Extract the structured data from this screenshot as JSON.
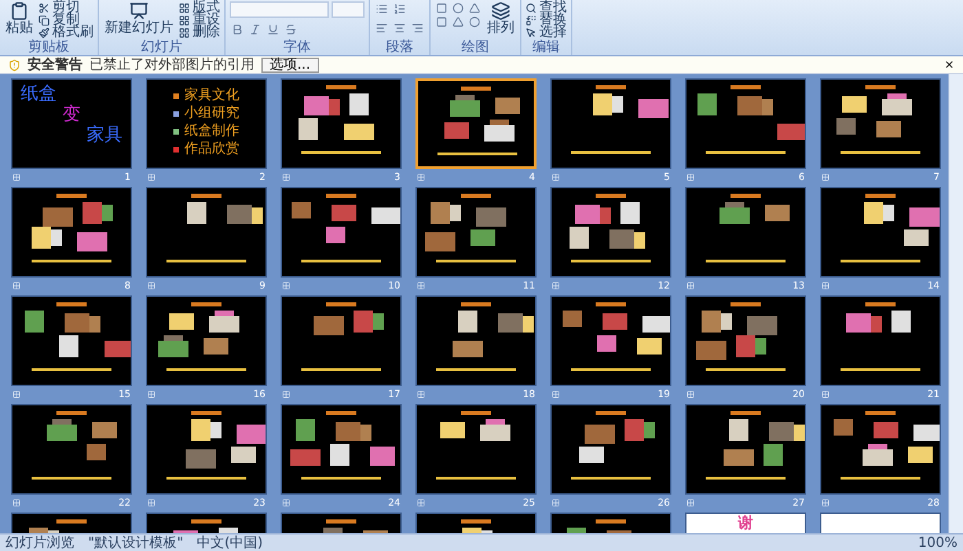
{
  "ribbon": {
    "groups": [
      {
        "kind": "clipboard",
        "label": "剪贴板",
        "big": "粘贴",
        "small": [
          "剪切",
          "复制",
          "格式刷"
        ]
      },
      {
        "kind": "slides",
        "label": "幻灯片",
        "big": "新建幻灯片",
        "small": [
          "版式",
          "重设",
          "删除"
        ]
      },
      {
        "kind": "font",
        "label": "字体"
      },
      {
        "kind": "paragraph",
        "label": "段落"
      },
      {
        "kind": "drawing",
        "label": "绘图",
        "big": "排列"
      },
      {
        "kind": "editing",
        "label": "编辑",
        "small": [
          "查找",
          "替换",
          "选择"
        ]
      }
    ]
  },
  "security_bar": {
    "title": "安全警告",
    "message": "已禁止了对外部图片的引用",
    "button": "选项..."
  },
  "slides": [
    {
      "kind": "title",
      "number": "1",
      "selected": false,
      "lines": [
        "纸盒",
        "变",
        "家具"
      ]
    },
    {
      "kind": "menu",
      "number": "2",
      "selected": false,
      "lines": [
        "家具文化",
        "小组研究",
        "纸盒制作",
        "作品欣赏"
      ]
    },
    {
      "kind": "photos",
      "number": "3",
      "selected": false
    },
    {
      "kind": "photos",
      "number": "4",
      "selected": true
    },
    {
      "kind": "photos",
      "number": "5",
      "selected": false
    },
    {
      "kind": "photos",
      "number": "6",
      "selected": false
    },
    {
      "kind": "photos",
      "number": "7",
      "selected": false
    },
    {
      "kind": "photos",
      "number": "8",
      "selected": false
    },
    {
      "kind": "photos",
      "number": "9",
      "selected": false
    },
    {
      "kind": "photos",
      "number": "10",
      "selected": false
    },
    {
      "kind": "photos",
      "number": "11",
      "selected": false
    },
    {
      "kind": "photos",
      "number": "12",
      "selected": false
    },
    {
      "kind": "photos",
      "number": "13",
      "selected": false
    },
    {
      "kind": "photos",
      "number": "14",
      "selected": false
    },
    {
      "kind": "photos",
      "number": "15",
      "selected": false
    },
    {
      "kind": "photos",
      "number": "16",
      "selected": false
    },
    {
      "kind": "photos",
      "number": "17",
      "selected": false
    },
    {
      "kind": "photos",
      "number": "18",
      "selected": false
    },
    {
      "kind": "photos",
      "number": "19",
      "selected": false
    },
    {
      "kind": "photos",
      "number": "20",
      "selected": false
    },
    {
      "kind": "photos",
      "number": "21",
      "selected": false
    },
    {
      "kind": "photos",
      "number": "22",
      "selected": false
    },
    {
      "kind": "photos",
      "number": "23",
      "selected": false
    },
    {
      "kind": "photos",
      "number": "24",
      "selected": false
    },
    {
      "kind": "photos",
      "number": "25",
      "selected": false
    },
    {
      "kind": "photos",
      "number": "26",
      "selected": false
    },
    {
      "kind": "photos",
      "number": "27",
      "selected": false
    },
    {
      "kind": "photos",
      "number": "28",
      "selected": false
    },
    {
      "kind": "photos",
      "selected": false
    },
    {
      "kind": "photos",
      "selected": false
    },
    {
      "kind": "photos",
      "selected": false
    },
    {
      "kind": "photos",
      "selected": false
    },
    {
      "kind": "photos",
      "selected": false
    },
    {
      "kind": "end",
      "selected": false,
      "lines": [
        "谢"
      ]
    },
    {
      "kind": "white",
      "selected": false
    }
  ],
  "status_bar": {
    "view": "幻灯片浏览",
    "theme": "\"默认设计模板\"",
    "language": "中文(中国)",
    "zoom": "100%"
  }
}
